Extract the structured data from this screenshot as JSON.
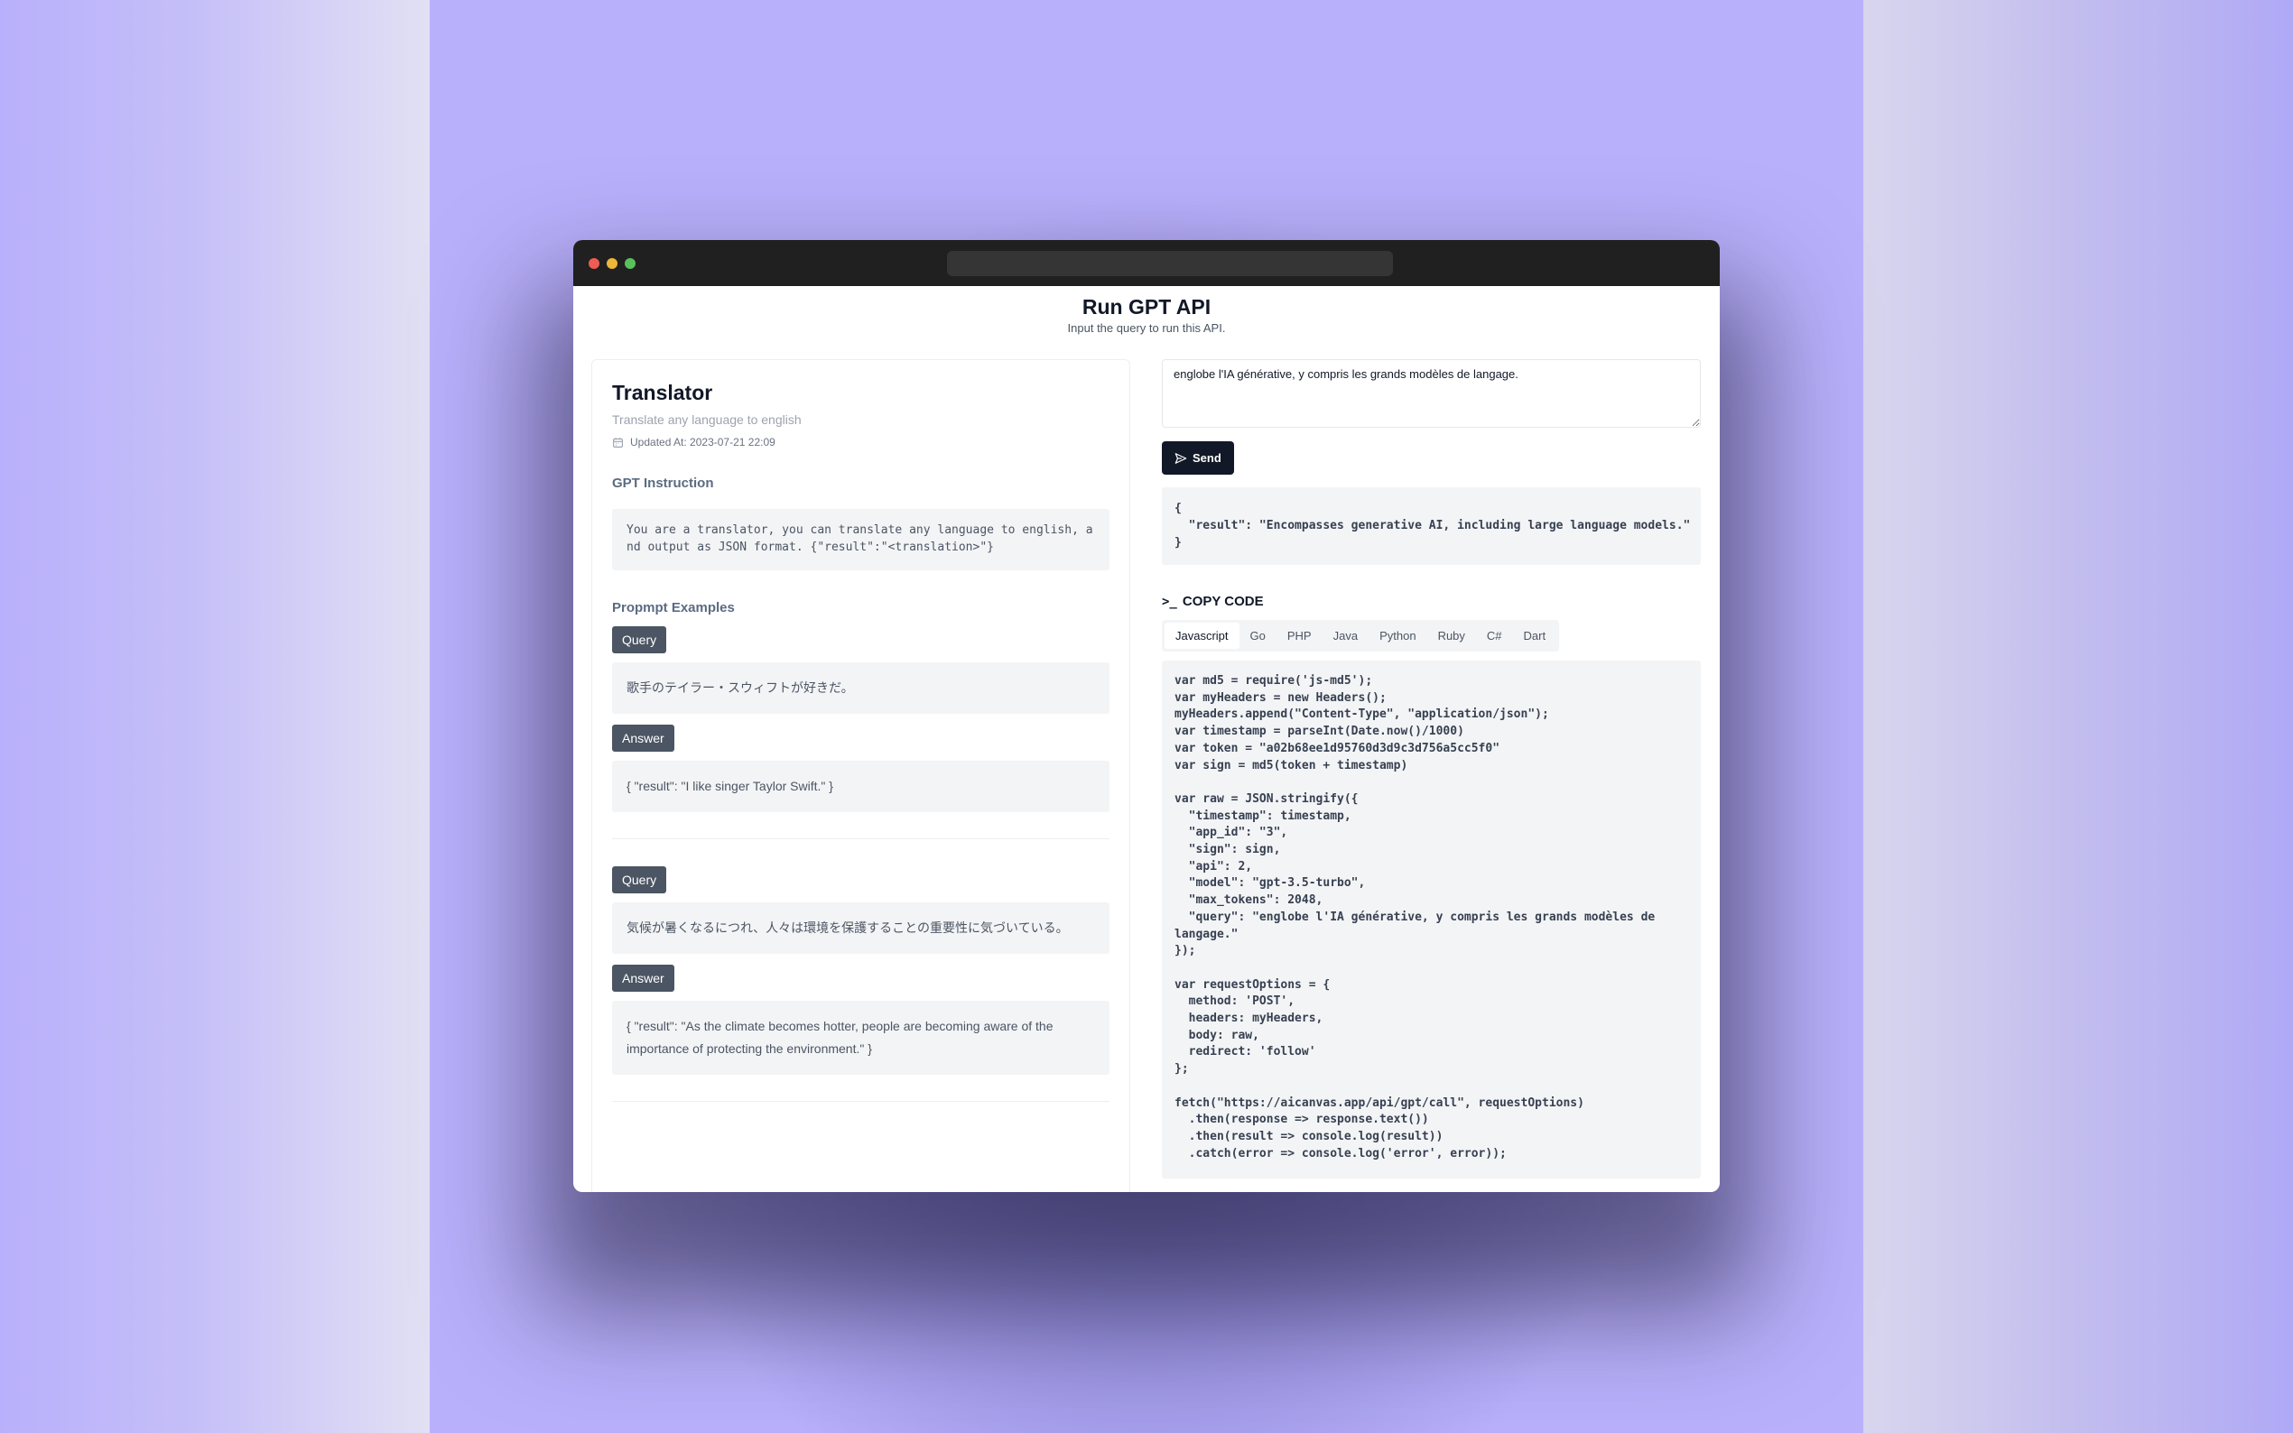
{
  "page": {
    "title": "Run GPT API",
    "subtitle": "Input the query to run this API."
  },
  "app": {
    "name": "Translator",
    "description": "Translate any language to english",
    "updated_at": "Updated At: 2023-07-21 22:09",
    "instruction_label": "GPT Instruction",
    "instruction": "You are a translator, you can translate any language to english, and output as JSON format. {\"result\":\"<translation>\"}",
    "examples_label": "Propmpt Examples",
    "query_badge": "Query",
    "answer_badge": "Answer",
    "examples": [
      {
        "query": "歌手のテイラー・スウィフトが好きだ。",
        "answer": "{ \"result\": \"I like singer Taylor Swift.\" }"
      },
      {
        "query": "気候が暑くなるにつれ、人々は環境を保護することの重要性に気づいている。",
        "answer": "{ \"result\": \"As the climate becomes hotter, people are becoming aware of the importance of protecting the environment.\" }"
      }
    ]
  },
  "runner": {
    "query_value": "englobe l'IA générative, y compris les grands modèles de langage.",
    "send_label": "Send",
    "result": "{\n  \"result\": \"Encompasses generative AI, including large language models.\"\n}"
  },
  "code": {
    "header_prompt": ">_",
    "header_label": "COPY CODE",
    "tabs": [
      "Javascript",
      "Go",
      "PHP",
      "Java",
      "Python",
      "Ruby",
      "C#",
      "Dart"
    ],
    "active_tab": "Javascript",
    "snippet": "var md5 = require('js-md5');\nvar myHeaders = new Headers();\nmyHeaders.append(\"Content-Type\", \"application/json\");\nvar timestamp = parseInt(Date.now()/1000)\nvar token = \"a02b68ee1d95760d3d9c3d756a5cc5f0\"\nvar sign = md5(token + timestamp)\n\nvar raw = JSON.stringify({\n  \"timestamp\": timestamp,\n  \"app_id\": \"3\",\n  \"sign\": sign,\n  \"api\": 2,\n  \"model\": \"gpt-3.5-turbo\",\n  \"max_tokens\": 2048,\n  \"query\": \"englobe l'IA générative, y compris les grands modèles de langage.\"\n});\n\nvar requestOptions = {\n  method: 'POST',\n  headers: myHeaders,\n  body: raw,\n  redirect: 'follow'\n};\n\nfetch(\"https://aicanvas.app/api/gpt/call\", requestOptions)\n  .then(response => response.text())\n  .then(result => console.log(result))\n  .catch(error => console.log('error', error));"
  },
  "icons": {
    "calendar": "calendar-icon",
    "send": "send-icon",
    "terminal": "terminal-icon"
  },
  "colors": {
    "background": "#b9b0fb",
    "badge": "#4b5563",
    "button": "#111827",
    "titlebar": "#202020"
  }
}
